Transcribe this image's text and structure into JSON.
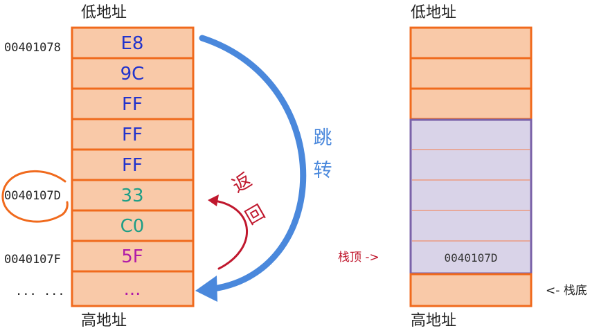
{
  "left_stack": {
    "top_label": "低地址",
    "bottom_label": "高地址",
    "cells": [
      {
        "value": "E8",
        "color": "#2233cc"
      },
      {
        "value": "9C",
        "color": "#2233cc"
      },
      {
        "value": "FF",
        "color": "#2233cc"
      },
      {
        "value": "FF",
        "color": "#2233cc"
      },
      {
        "value": "FF",
        "color": "#2233cc"
      },
      {
        "value": "33",
        "color": "#1e9e86"
      },
      {
        "value": "C0",
        "color": "#1e9e86"
      },
      {
        "value": "5F",
        "color": "#b01aa8"
      },
      {
        "value": "...",
        "color": "#b01aa8"
      }
    ],
    "addresses": {
      "addr_0": "00401078",
      "addr_5": "0040107D",
      "addr_7": "0040107F",
      "addr_8": "... ..."
    }
  },
  "right_stack": {
    "top_label": "低地址",
    "bottom_label": "高地址",
    "stack_value": "0040107D",
    "top_pointer_label": "栈顶 ->",
    "bottom_pointer_label": "<- 栈底"
  },
  "annotations": {
    "jump_label": [
      "跳",
      "转"
    ],
    "return_label": [
      "返",
      "回"
    ]
  },
  "colors": {
    "cell_fill": "#f9c9a8",
    "cell_border": "#f06a1d",
    "stack_fill": "#d9d3e8",
    "stack_border": "#7a62a8",
    "jump_arrow": "#4a88dc",
    "return_arrow": "#c0182e",
    "highlight_circle": "#f06a1d"
  }
}
